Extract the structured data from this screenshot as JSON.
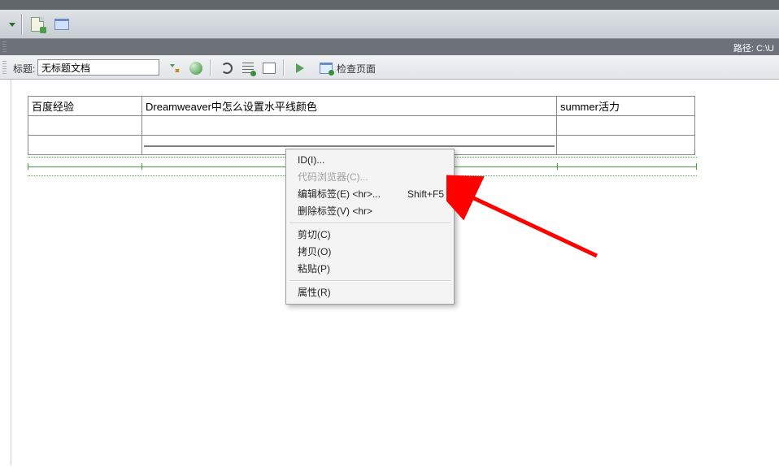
{
  "dark_bar": {
    "path_label": "路径:  C:\\U"
  },
  "doc_bar": {
    "title_label": "标题:",
    "title_value": "无标题文档",
    "check_page_label": "检查页面"
  },
  "table": {
    "rows": [
      [
        "百度经验",
        "Dreamweaver中怎么设置水平线颜色",
        "summer活力"
      ],
      [
        "",
        "",
        ""
      ],
      [
        "",
        "",
        ""
      ]
    ]
  },
  "context_menu": {
    "items": [
      {
        "label": "ID(I)...",
        "enabled": true,
        "shortcut": ""
      },
      {
        "label": "代码浏览器(C)...",
        "enabled": false,
        "shortcut": ""
      },
      {
        "label": "编辑标签(E) <hr>...",
        "enabled": true,
        "shortcut": "Shift+F5"
      },
      {
        "label": "删除标签(V) <hr>",
        "enabled": true,
        "shortcut": ""
      },
      {
        "sep": true
      },
      {
        "label": "剪切(C)",
        "enabled": true,
        "shortcut": ""
      },
      {
        "label": "拷贝(O)",
        "enabled": true,
        "shortcut": ""
      },
      {
        "label": "粘贴(P)",
        "enabled": true,
        "shortcut": ""
      },
      {
        "sep": true
      },
      {
        "label": "属性(R)",
        "enabled": true,
        "shortcut": ""
      }
    ]
  }
}
